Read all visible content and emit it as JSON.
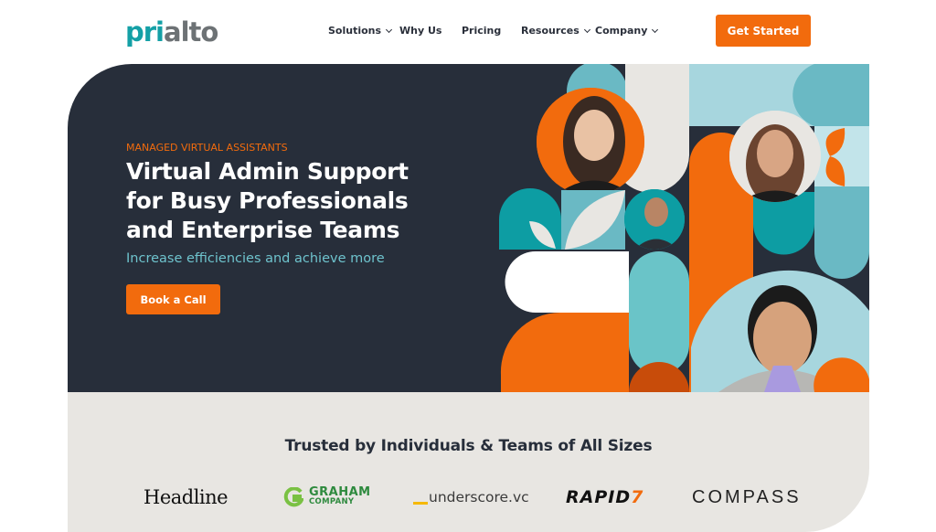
{
  "header": {
    "logo": {
      "part1": "pri",
      "part2": "alto"
    },
    "nav": [
      {
        "label": "Solutions",
        "has_dropdown": true
      },
      {
        "label": "Why Us",
        "has_dropdown": false
      },
      {
        "label": "Pricing",
        "has_dropdown": false
      },
      {
        "label": "Resources",
        "has_dropdown": true
      },
      {
        "label": "Company",
        "has_dropdown": true
      }
    ],
    "cta_label": "Get Started"
  },
  "hero": {
    "eyebrow": "MANAGED VIRTUAL ASSISTANTS",
    "title_lines": [
      "Virtual Admin Support",
      "for Busy Professionals",
      "and Enterprise Teams"
    ],
    "subtitle": "Increase efficiencies and achieve more",
    "cta_label": "Book a Call",
    "photos": [
      "assistant-woman-1",
      "assistant-man-1",
      "assistant-woman-2",
      "assistant-man-2"
    ]
  },
  "trusted": {
    "title": "Trusted by Individuals & Teams of All Sizes",
    "brands": {
      "headline": "Headline",
      "graham_line1": "GRAHAM",
      "graham_line2": "COMPANY",
      "underscore": "underscore.vc",
      "rapid": "RAPID",
      "rapid_mark": "7",
      "compass": "COMPASS"
    }
  },
  "colors": {
    "brand_orange": "#f26b0d",
    "brand_teal": "#14a0a6",
    "hero_bg": "#272e3a",
    "subtitle_teal": "#6ec3cd",
    "section_gray": "#e8e6e2"
  }
}
